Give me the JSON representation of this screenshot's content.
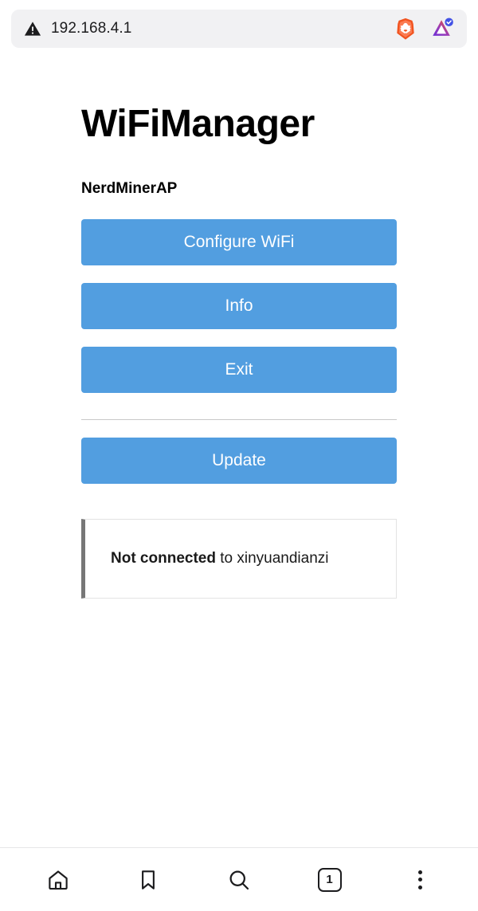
{
  "browser": {
    "url": "192.168.4.1",
    "security_icon": "warning-triangle-icon",
    "shield_icon": "brave-shield-lion-icon",
    "leo_icon": "brave-leo-ai-icon",
    "leo_badge": "verified-check-badge"
  },
  "page": {
    "title": "WiFiManager",
    "ap_name": "NerdMinerAP",
    "buttons": [
      {
        "label": "Configure WiFi",
        "name": "configure-wifi-button"
      },
      {
        "label": "Info",
        "name": "info-button"
      },
      {
        "label": "Exit",
        "name": "exit-button"
      }
    ],
    "update_button": "Update",
    "status": {
      "strong": "Not connected",
      "rest": " to xinyuandianzi"
    }
  },
  "bottom_nav": {
    "home": "home-icon",
    "bookmarks": "bookmark-icon",
    "search": "search-icon",
    "tab_count": "1",
    "menu": "more-vertical-icon"
  },
  "colors": {
    "button_blue": "#529ee0",
    "urlbar_bg": "#f1f1f3",
    "status_border": "#777777",
    "brave_orange": "#fb542b",
    "leo_purple": "#5e35b1",
    "badge_blue": "#4252e5"
  }
}
